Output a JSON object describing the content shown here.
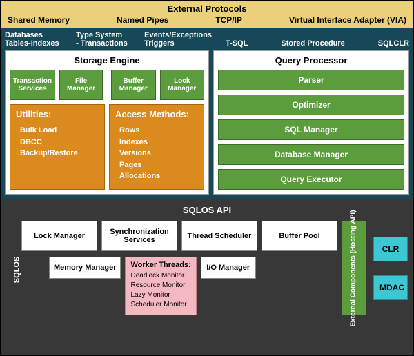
{
  "protocols": {
    "title": "External Protocols",
    "items": [
      "Shared Memory",
      "Named Pipes",
      "TCP/IP",
      "Virtual Interface Adapter (VIA)"
    ]
  },
  "main_labels": {
    "left": {
      "c1a": "Databases",
      "c1b": "Tables-Indexes",
      "c2a": "Type System",
      "c2b": "- Transactions",
      "c3a": "Events/Exceptions",
      "c3b": "Triggers"
    },
    "right": [
      "T-SQL",
      "Stored Procedure",
      "SQLCLR"
    ]
  },
  "storage_engine": {
    "title": "Storage Engine",
    "top_left": [
      "Transaction Services",
      "File Manager"
    ],
    "top_right": [
      "Buffer Manager",
      "Lock Manager"
    ],
    "utilities": {
      "title": "Utilities:",
      "items": [
        "Bulk Load",
        "DBCC",
        "Backup/Restore"
      ]
    },
    "access_methods": {
      "title": "Access Methods:",
      "items": [
        "Rows",
        "Indexes",
        "Versions",
        "Pages",
        "Allocations"
      ]
    }
  },
  "query_processor": {
    "title": "Query Processor",
    "items": [
      "Parser",
      "Optimizer",
      "SQL Manager",
      "Database Manager",
      "Query Executor"
    ]
  },
  "sqlos_api": "SQLOS API",
  "sqlos": {
    "label": "SQLOS",
    "row1": [
      "Lock Manager",
      "Synchronization Services",
      "Thread Scheduler",
      "Buffer Pool"
    ],
    "row2_left": "Memory Manager",
    "worker_threads": {
      "title": "Worker Threads:",
      "items": [
        "Deadlock Monitor",
        "Resource Monitor",
        "Lazy Monitor",
        "Scheduler Monitor"
      ]
    },
    "row2_right": "I/O Manager",
    "ext_components": "External Components\n(Hosting API)",
    "clr": "CLR",
    "mdac": "MDAC"
  }
}
